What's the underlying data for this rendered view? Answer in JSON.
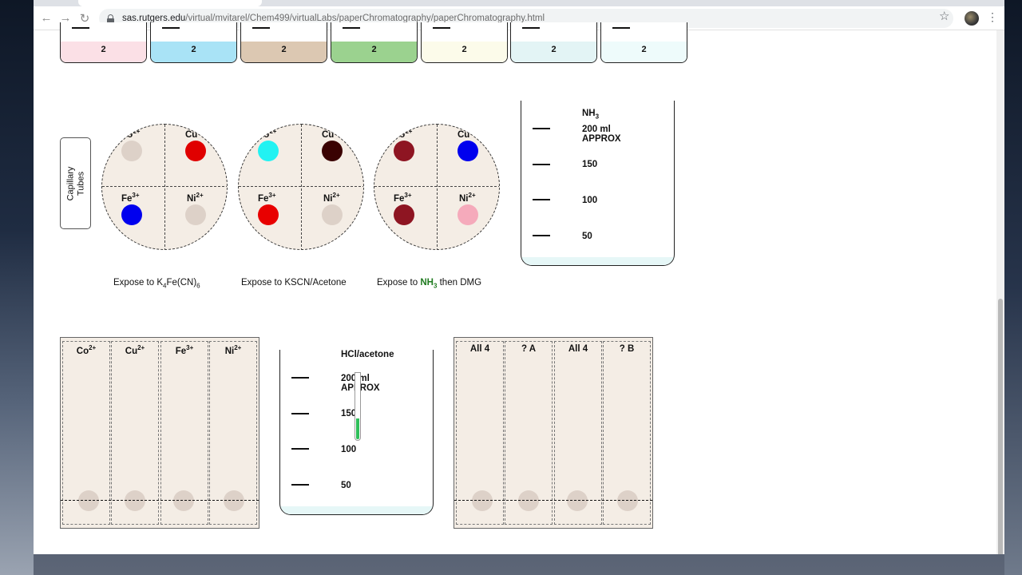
{
  "browser": {
    "url_host": "sas.rutgers.edu",
    "url_path": "/virtual/mvitarel/Chem499/virtualLabs/paperChromatography/paperChromatography.html"
  },
  "vials": [
    {
      "number": "2",
      "color": "#fbe0e6"
    },
    {
      "number": "2",
      "color": "#a9e3f6"
    },
    {
      "number": "2",
      "color": "#dcc8b2"
    },
    {
      "number": "2",
      "color": "#9bd28f"
    },
    {
      "number": "2",
      "color": "#fcfbea"
    },
    {
      "number": "2",
      "color": "#e3f4f5"
    },
    {
      "number": "2",
      "color": "#eefbfb"
    }
  ],
  "capillary": {
    "line1": "Capillary",
    "line2": "Tubes"
  },
  "ions": {
    "co": "Co",
    "cu": "Cu",
    "fe": "Fe",
    "ni": "Ni",
    "charge2": "2+",
    "charge3": "3+"
  },
  "plates": [
    {
      "label_prefix": "Expose to K",
      "label_sub1": "4",
      "label_mid": "Fe(CN)",
      "label_sub2": "6",
      "colors": {
        "co": "#ddd1c8",
        "cu": "#e00000",
        "fe": "#0000ee",
        "ni": "#ddd1c8"
      }
    },
    {
      "label": "Expose to KSCN/Acetone",
      "colors": {
        "co": "#22f2f2",
        "cu": "#3a0202",
        "fe": "#e80000",
        "ni": "#ddd1c8"
      }
    },
    {
      "label_prefix": "Expose to ",
      "label_nh": "NH",
      "label_nh_sub": "3",
      "label_suffix": " then DMG",
      "colors": {
        "co": "#8e1522",
        "cu": "#0000ee",
        "fe": "#8e1522",
        "ni": "#f5aabb"
      }
    }
  ],
  "beaker_nh3": {
    "solvent": "NH",
    "solvent_sub": "3",
    "mark_200": "200 ml",
    "mark_200b": "APPROX",
    "mark_150": "150",
    "mark_100": "100",
    "mark_50": "50"
  },
  "beaker_hcl": {
    "solvent": "HCl/acetone",
    "mark_200": "200 ml",
    "mark_200b": "APPROX",
    "mark_150": "150",
    "mark_100": "100",
    "mark_50": "50"
  },
  "paper_known": {
    "lanes": [
      {
        "ion": "Co",
        "charge": "2+"
      },
      {
        "ion": "Cu",
        "charge": "2+"
      },
      {
        "ion": "Fe",
        "charge": "3+"
      },
      {
        "ion": "Ni",
        "charge": "2+"
      }
    ]
  },
  "paper_unknown": {
    "lanes": [
      "All 4",
      "? A",
      "All 4",
      "? B"
    ]
  }
}
